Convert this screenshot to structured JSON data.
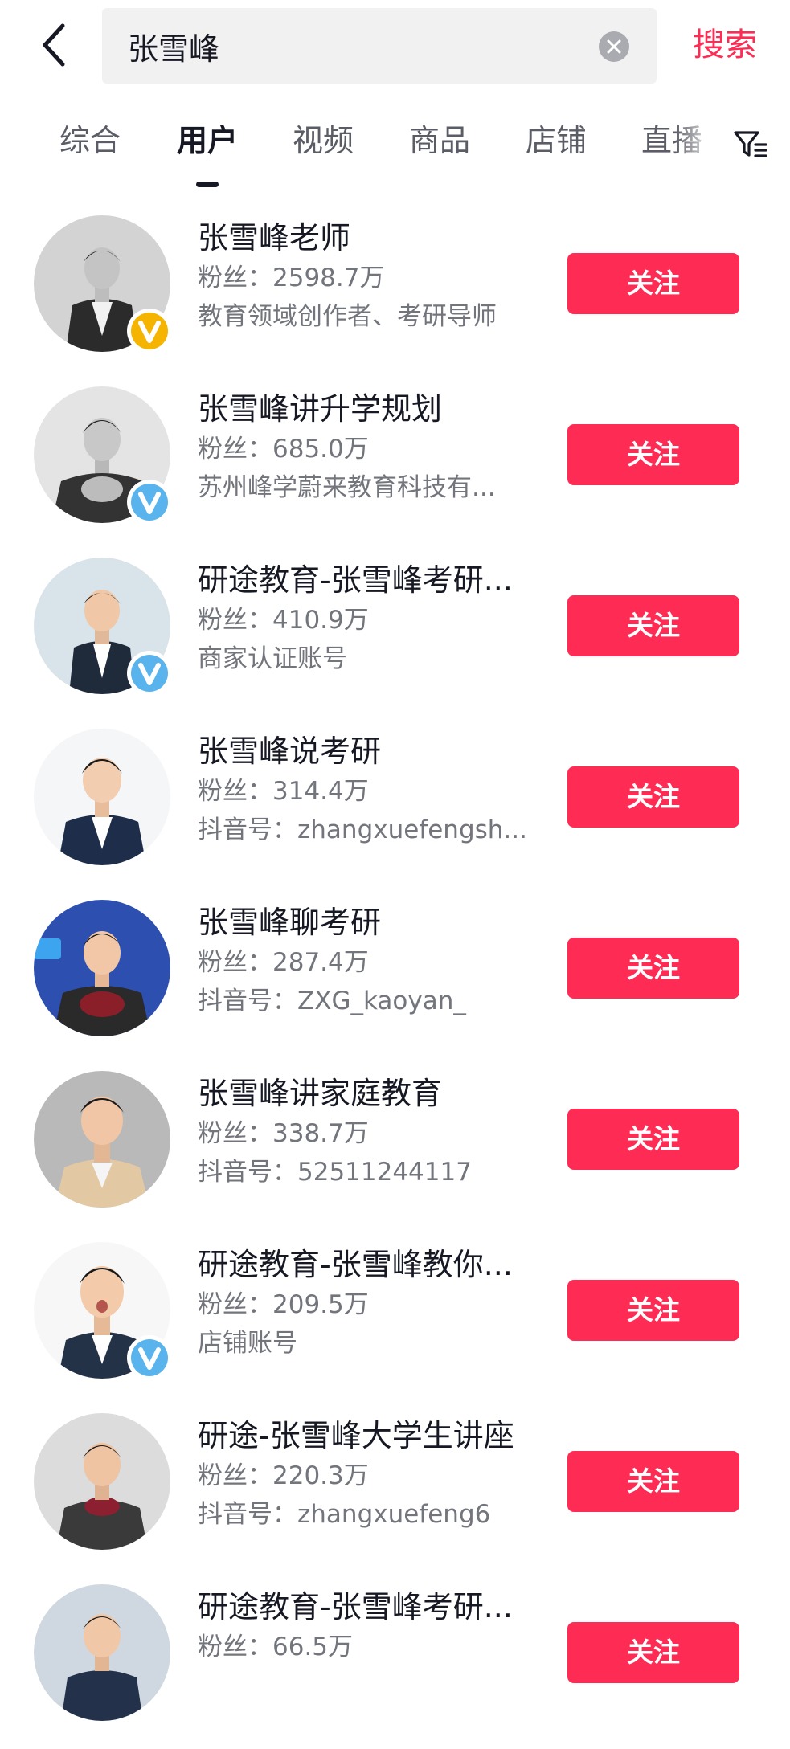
{
  "search": {
    "query": "张雪峰",
    "button_label": "搜索"
  },
  "tabs": [
    {
      "label": "综合",
      "active": false
    },
    {
      "label": "用户",
      "active": true
    },
    {
      "label": "视频",
      "active": false
    },
    {
      "label": "商品",
      "active": false
    },
    {
      "label": "店铺",
      "active": false
    },
    {
      "label": "直播",
      "active": false
    }
  ],
  "colors": {
    "accent": "#fe2c55",
    "primary_text": "#161823",
    "secondary_text": "#73757c",
    "gold_badge": "#f5b400",
    "blue_badge": "#59b4ee"
  },
  "icons": {
    "back": "chevron-left-icon",
    "clear": "clear-circle-icon",
    "filter": "filter-icon",
    "verified_gold": "verified-v-gold-icon",
    "verified_blue": "verified-v-blue-icon"
  },
  "users": [
    {
      "name": "张雪峰老师",
      "fans": "粉丝：2598.7万",
      "desc": "教育领域创作者、考研导师",
      "badge": "gold",
      "follow_label": "关注"
    },
    {
      "name": "张雪峰讲升学规划",
      "fans": "粉丝：685.0万",
      "desc": "苏州峰学蔚来教育科技有...",
      "badge": "blue",
      "follow_label": "关注"
    },
    {
      "name": "研途教育-张雪峰考研...",
      "fans": "粉丝：410.9万",
      "desc": "商家认证账号",
      "badge": "blue",
      "follow_label": "关注"
    },
    {
      "name": "张雪峰说考研",
      "fans": "粉丝：314.4万",
      "desc": "抖音号：zhangxuefengsh...",
      "badge": "none",
      "follow_label": "关注"
    },
    {
      "name": "张雪峰聊考研",
      "fans": "粉丝：287.4万",
      "desc": "抖音号：ZXG_kaoyan_",
      "badge": "none",
      "follow_label": "关注"
    },
    {
      "name": "张雪峰讲家庭教育",
      "fans": "粉丝：338.7万",
      "desc": "抖音号：52511244117",
      "badge": "none",
      "follow_label": "关注"
    },
    {
      "name": "研途教育-张雪峰教你...",
      "fans": "粉丝：209.5万",
      "desc": "店铺账号",
      "badge": "blue",
      "follow_label": "关注"
    },
    {
      "name": "研途-张雪峰大学生讲座",
      "fans": "粉丝：220.3万",
      "desc": "抖音号：zhangxuefeng6",
      "badge": "none",
      "follow_label": "关注"
    },
    {
      "name": "研途教育-张雪峰考研...",
      "fans": "粉丝：66.5万",
      "desc": "",
      "badge": "none",
      "follow_label": "关注"
    }
  ]
}
